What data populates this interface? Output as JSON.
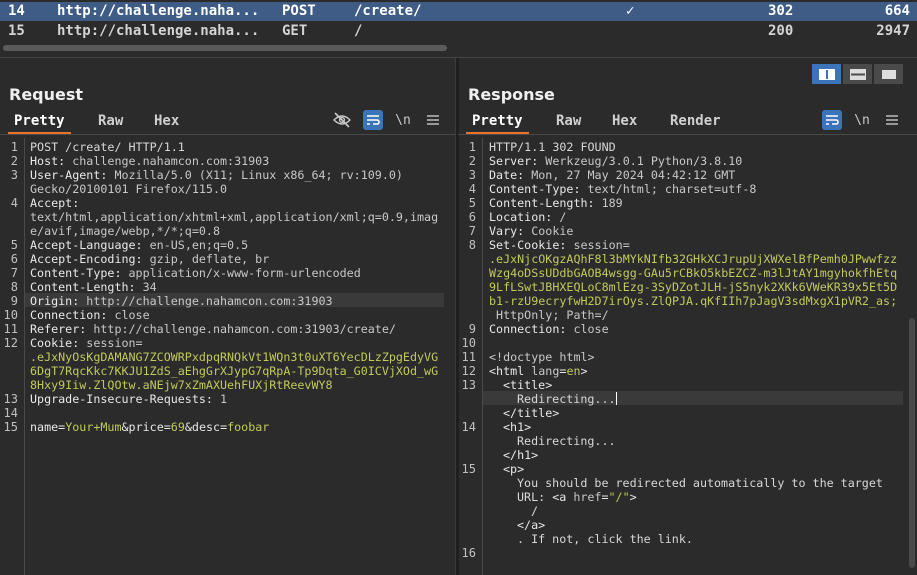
{
  "history": {
    "rows": [
      {
        "num": "14",
        "host": "http://challenge.naha...",
        "method": "POST",
        "url": "/create/",
        "check": "✓",
        "status": "302",
        "length": "664",
        "selected": true
      },
      {
        "num": "15",
        "host": "http://challenge.naha...",
        "method": "GET",
        "url": "/",
        "check": "",
        "status": "200",
        "length": "2947",
        "selected": false
      }
    ]
  },
  "request": {
    "title": "Request",
    "tabs": [
      "Pretty",
      "Raw",
      "Hex"
    ],
    "active_tab": "Pretty",
    "icons": [
      "eye-off-icon",
      "wrap-icon",
      "newline-icon",
      "menu-icon"
    ],
    "newline_label": "\\n",
    "lines": {
      "l1": "POST /create/ HTTP/1.1",
      "l2k": "Host:",
      "l2v": " challenge.nahamcon.com:31903",
      "l3k": "User-Agent:",
      "l3v": " Mozilla/5.0 (X11; Linux x86_64; rv:109.0)",
      "l3b": "Gecko/20100101 Firefox/115.0",
      "l4k": "Accept:",
      "l4a": "text/html,application/xhtml+xml,application/xml;q=0.9,imag",
      "l4b": "e/avif,image/webp,*/*;q=0.8",
      "l5k": "Accept-Language:",
      "l5v": " en-US,en;q=0.5",
      "l6k": "Accept-Encoding:",
      "l6v": " gzip, deflate, br",
      "l7k": "Content-Type:",
      "l7v": " application/x-www-form-urlencoded",
      "l8k": "Content-Length:",
      "l8v": " 34",
      "l9k": "Origin:",
      "l9v": " http://challenge.nahamcon.com:31903",
      "l10k": "Connection:",
      "l10v": " close",
      "l11k": "Referer:",
      "l11v": " http://challenge.nahamcon.com:31903/create/",
      "l12k": "Cookie:",
      "l12v": " session=",
      "l12a": ".eJxNyOsKgDAMANG7ZCOWRPxdpqRNQkVt1WQn3t0uXT6YecDLzZpgEdyVG",
      "l12b": "6DgT7RqcKkc7KKJU1ZdS_aEhgGrXJypG7qRpA-Tp9Dqta_G0ICVjXOd_wG",
      "l12c": "8Hxy9Iiw.ZlQOtw.aNEjw7xZmAXUehFUXjRtReevWY8",
      "l13k": "Upgrade-Insecure-Requests:",
      "l13v": " 1",
      "l15_name": "name",
      "l15_eq1": "=",
      "l15_nv": "Your+Mum",
      "l15_amp1": "&",
      "l15_price": "price",
      "l15_eq2": "=",
      "l15_pv": "69",
      "l15_amp2": "&",
      "l15_desc": "desc",
      "l15_eq3": "=",
      "l15_dv": "foobar"
    }
  },
  "response": {
    "title": "Response",
    "tabs": [
      "Pretty",
      "Raw",
      "Hex",
      "Render"
    ],
    "active_tab": "Pretty",
    "newline_label": "\\n",
    "lines": {
      "l1": "HTTP/1.1 302 FOUND",
      "l2k": "Server:",
      "l2v": " Werkzeug/3.0.1 Python/3.8.10",
      "l3k": "Date:",
      "l3v": " Mon, 27 May 2024 04:42:12 GMT",
      "l4k": "Content-Type:",
      "l4v": " text/html; charset=utf-8",
      "l5k": "Content-Length:",
      "l5v": " 189",
      "l6k": "Location:",
      "l6v": " /",
      "l7k": "Vary:",
      "l7v": " Cookie",
      "l8k": "Set-Cookie:",
      "l8v": " session=",
      "l8a": ".eJxNjcOKgzAQhF8l3bMYkNIfb32GHkXCJrupUjXWXelBfPemh0JPwwfzz",
      "l8b": "Wzg4oDSsUDdbGAOB4wsgg-GAu5rCBkO5kbEZCZ-m3lJtAY1mgyhokfhEtq",
      "l8c": "9LfLSwtJBHXEQLoC8mlEzg-3SyDZotJLH-jS5nyk2XKk6VWeKR39x5Et5D",
      "l8d": "b1-rzU9ecryfwH2D7irOys.ZlQPJA.qKfIIh7pJagV3sdMxgX1pVR2_as;",
      "l8e": " HttpOnly; Path=/",
      "l9k": "Connection:",
      "l9v": " close",
      "l11": "<!doctype html>",
      "l12a": "<html ",
      "l12b": "lang",
      "l12c": "=",
      "l12d": "en",
      "l12e": ">",
      "l13a": "<title>",
      "l13b": "Redirecting...",
      "l13c": "</title>",
      "l14a": "<h1>",
      "l14b": "Redirecting...",
      "l14c": "</h1>",
      "l15a": "<p>",
      "l15b": "You should be redirected automatically to the target",
      "l15c": "URL: ",
      "l15d": "<a ",
      "l15e": "href",
      "l15f": "=",
      "l15g": "\"/\"",
      "l15h": ">",
      "l15i": "/",
      "l15j": "</a>",
      "l15k": ". If not, click the link."
    }
  }
}
